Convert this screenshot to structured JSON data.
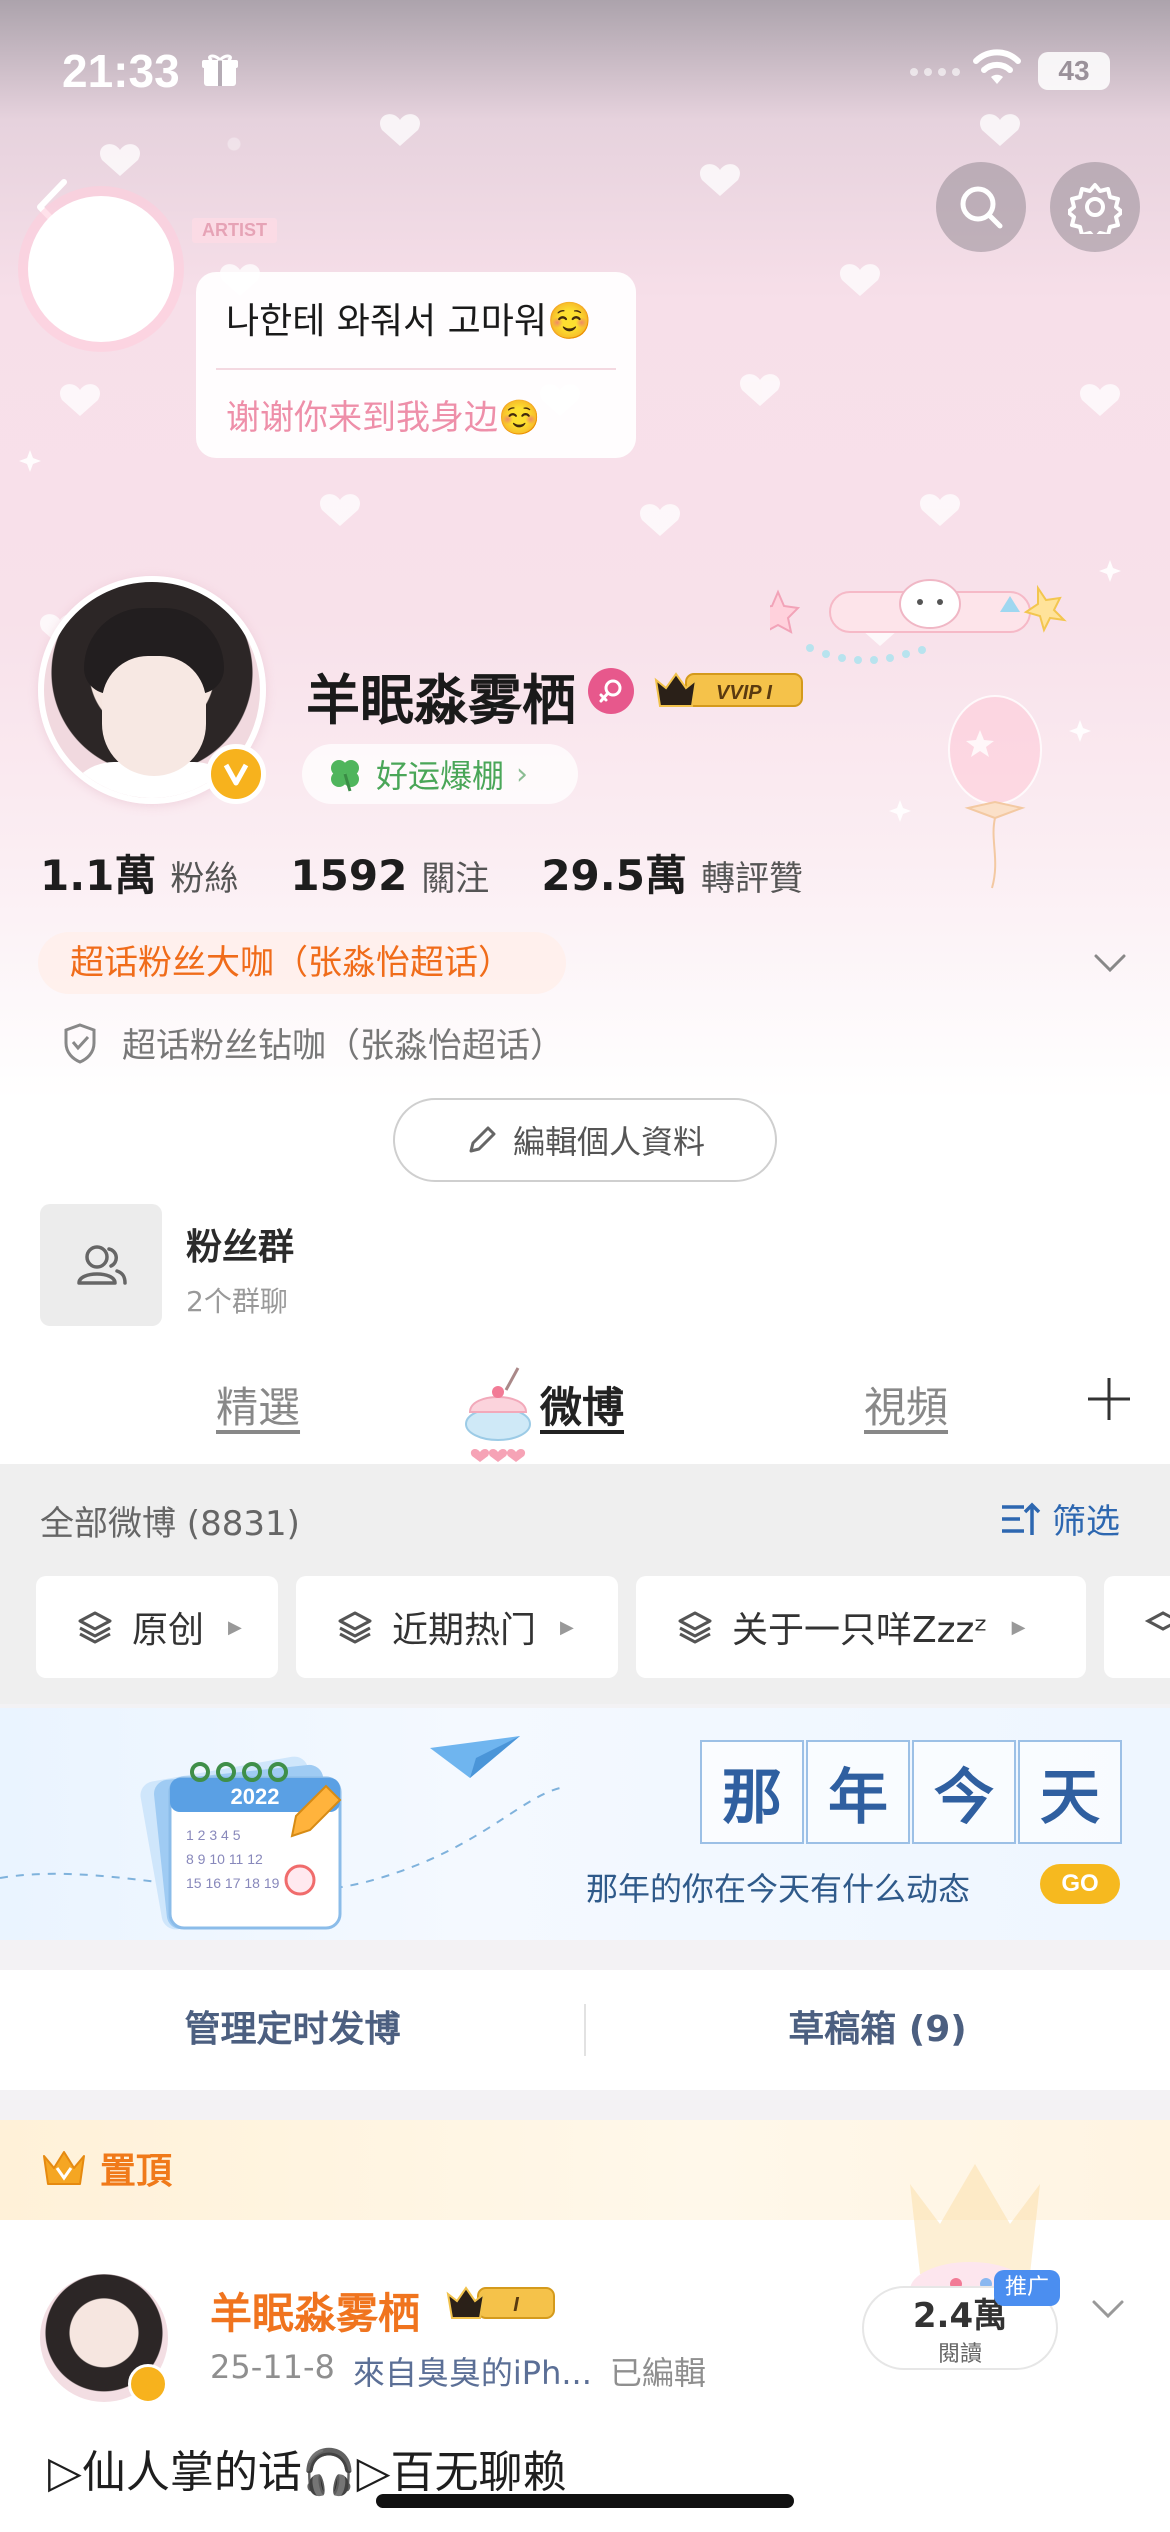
{
  "status_bar": {
    "time": "21:33",
    "battery": "43"
  },
  "cover": {
    "artist_tag": "ARTIST",
    "line1": "나한테 와줘서 고마워☺️",
    "line2": "谢谢你来到我身边☺️"
  },
  "profile": {
    "name": "羊眠淼雾栖",
    "vip_label": "VVIP I",
    "lucky_tag": "好运爆棚",
    "stats": [
      {
        "value": "1.1萬",
        "label": "粉絲"
      },
      {
        "value": "1592",
        "label": "關注"
      },
      {
        "value": "29.5萬",
        "label": "轉評贊"
      }
    ],
    "fan_title": "超话粉丝大咖（张淼怡超话）",
    "fan_title_secondary": "超话粉丝钻咖（张淼怡超话）",
    "edit_button": "編輯個人資料",
    "fan_group": {
      "title": "粉丝群",
      "subtitle": "2个群聊"
    }
  },
  "tabs": [
    "精選",
    "微博",
    "視頻"
  ],
  "feed_header": {
    "all_weibo": "全部微博 (8831)",
    "filter": "筛选",
    "chips": [
      "原创",
      "近期热门",
      "关于一只咩Zzzᶻ"
    ]
  },
  "banner": {
    "chars": [
      "那",
      "年",
      "今",
      "天"
    ],
    "subtitle": "那年的你在今天有什么动态",
    "go": "GO",
    "calendar_year": "2022"
  },
  "manage": {
    "scheduled": "管理定时发博",
    "drafts": "草稿箱 (9)"
  },
  "pinned_post": {
    "pinned_label": "置頂",
    "author": "羊眠淼雾栖",
    "badge": "I",
    "date": "25-11-8",
    "source": "來自臭臭的iPh...",
    "edited": "已編輯",
    "reads_value": "2.4萬",
    "reads_label": "閱讀",
    "promo": "推广",
    "text": "▷仙人掌的话🎧▷百无聊赖"
  },
  "colors": {
    "accent_orange": "#f06c1a",
    "link_blue": "#2d67b0",
    "verified_gold": "#f7b21d",
    "lucky_green": "#4aa658"
  }
}
